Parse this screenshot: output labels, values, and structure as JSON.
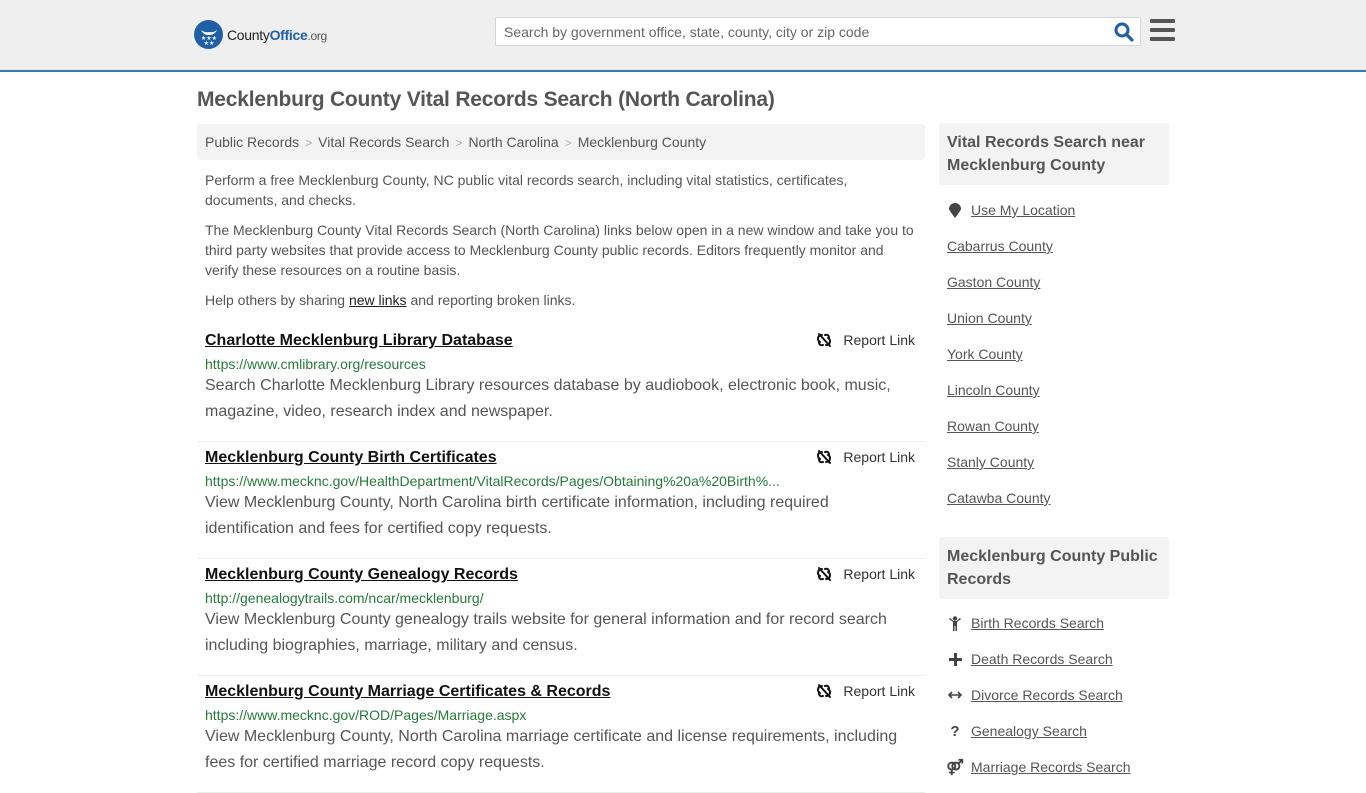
{
  "header": {
    "logo": {
      "county": "County",
      "office": "Office",
      "org": ".org"
    },
    "search": {
      "placeholder": "Search by government office, state, county, city or zip code",
      "value": ""
    },
    "accent_color": "#1f5fa6"
  },
  "page": {
    "title": "Mecklenburg County Vital Records Search (North Carolina)"
  },
  "breadcrumb": [
    "Public Records",
    "Vital Records Search",
    "North Carolina",
    "Mecklenburg County"
  ],
  "intro": {
    "p1": "Perform a free Mecklenburg County, NC public vital records search, including vital statistics, certificates, documents, and checks.",
    "p2": "The Mecklenburg County Vital Records Search (North Carolina) links below open in a new window and take you to third party websites that provide access to Mecklenburg County public records. Editors frequently monitor and verify these resources on a routine basis.",
    "p3_before": "Help others by sharing ",
    "p3_link": "new links",
    "p3_after": " and reporting broken links."
  },
  "results": [
    {
      "title": "Charlotte Mecklenburg Library Database",
      "url": "https://www.cmlibrary.org/resources",
      "description": "Search Charlotte Mecklenburg Library resources database by audiobook, electronic book, music, magazine, video, research index and newspaper.",
      "report_label": "Report Link"
    },
    {
      "title": "Mecklenburg County Birth Certificates",
      "url": "https://www.mecknc.gov/HealthDepartment/VitalRecords/Pages/Obtaining%20a%20Birth%...",
      "description": "View Mecklenburg County, North Carolina birth certificate information, including required identification and fees for certified copy requests.",
      "report_label": "Report Link"
    },
    {
      "title": "Mecklenburg County Genealogy Records",
      "url": "http://genealogytrails.com/ncar/mecklenburg/",
      "description": "View Mecklenburg County genealogy trails website for general information and for record search including biographies, marriage, military and census.",
      "report_label": "Report Link"
    },
    {
      "title": "Mecklenburg County Marriage Certificates & Records",
      "url": "https://www.mecknc.gov/ROD/Pages/Marriage.aspx",
      "description": "View Mecklenburg County, North Carolina marriage certificate and license requirements, including fees for certified marriage record copy requests.",
      "report_label": "Report Link"
    }
  ],
  "sidebar": {
    "nearby": {
      "heading": "Vital Records Search near Mecklenburg County",
      "use_location": "Use My Location",
      "items": [
        "Cabarrus County",
        "Gaston County",
        "Union County",
        "York County",
        "Lincoln County",
        "Rowan County",
        "Stanly County",
        "Catawba County"
      ]
    },
    "public_records": {
      "heading": "Mecklenburg County Public Records",
      "items": [
        {
          "icon": "child-icon",
          "label": "Birth Records Search"
        },
        {
          "icon": "plus-icon",
          "label": "Death Records Search"
        },
        {
          "icon": "arrows-horizontal-icon",
          "label": "Divorce Records Search"
        },
        {
          "icon": "question-icon",
          "label": "Genealogy Search"
        },
        {
          "icon": "gender-icon",
          "label": "Marriage Records Search"
        }
      ]
    }
  }
}
